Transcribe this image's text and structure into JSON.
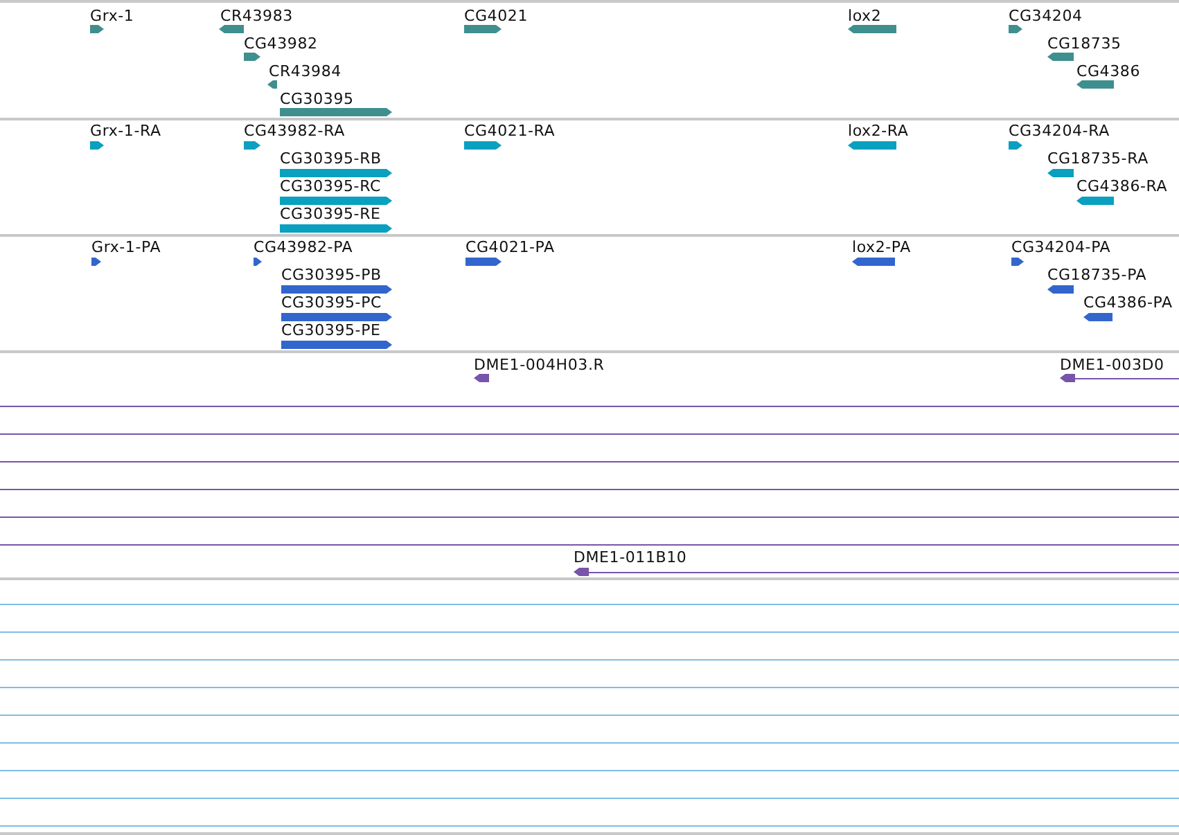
{
  "tracks": [
    {
      "color": "#3f8f8f",
      "features": [
        {
          "kind": "block",
          "label": "Grx-1",
          "reverse": false
        },
        {
          "kind": "block",
          "label": "CR43983",
          "reverse": true
        },
        {
          "kind": "block",
          "label": "CG43982",
          "reverse": false
        },
        {
          "kind": "block",
          "label": "CR43984",
          "reverse": true
        },
        {
          "kind": "block",
          "label": "CG30395",
          "reverse": false
        },
        {
          "kind": "block",
          "label": "CG4021",
          "reverse": false
        },
        {
          "kind": "block",
          "label": "lox2",
          "reverse": true
        },
        {
          "kind": "block",
          "label": "CG34204",
          "reverse": false
        },
        {
          "kind": "block",
          "label": "CG18735",
          "reverse": true
        },
        {
          "kind": "block",
          "label": "CG4386",
          "reverse": true
        }
      ]
    },
    {
      "color": "#0aa0bf",
      "features": [
        {
          "kind": "block",
          "label": "Grx-1-RA",
          "reverse": false
        },
        {
          "kind": "block",
          "label": "CG43982-RA",
          "reverse": false
        },
        {
          "kind": "block",
          "label": "CG30395-RB",
          "reverse": false
        },
        {
          "kind": "block",
          "label": "CG30395-RC",
          "reverse": false
        },
        {
          "kind": "block",
          "label": "CG30395-RE",
          "reverse": false
        },
        {
          "kind": "block",
          "label": "CG4021-RA",
          "reverse": false
        },
        {
          "kind": "block",
          "label": "lox2-RA",
          "reverse": true
        },
        {
          "kind": "block",
          "label": "CG34204-RA",
          "reverse": false
        },
        {
          "kind": "block",
          "label": "CG18735-RA",
          "reverse": true
        },
        {
          "kind": "block",
          "label": "CG4386-RA",
          "reverse": true
        }
      ]
    },
    {
      "color": "#3366cc",
      "features": [
        {
          "kind": "block",
          "label": "Grx-1-PA",
          "reverse": false
        },
        {
          "kind": "block",
          "label": "CG43982-PA",
          "reverse": false
        },
        {
          "kind": "block",
          "label": "CG30395-PB",
          "reverse": false
        },
        {
          "kind": "block",
          "label": "CG30395-PC",
          "reverse": false
        },
        {
          "kind": "block",
          "label": "CG30395-PE",
          "reverse": false
        },
        {
          "kind": "block",
          "label": "CG4021-PA",
          "reverse": false
        },
        {
          "kind": "block",
          "label": "lox2-PA",
          "reverse": true
        },
        {
          "kind": "block",
          "label": "CG34204-PA",
          "reverse": false
        },
        {
          "kind": "block",
          "label": "CG18735-PA",
          "reverse": true
        },
        {
          "kind": "block",
          "label": "CG4386-PA",
          "reverse": true
        }
      ]
    },
    {
      "color": "#7755aa",
      "features": [
        {
          "kind": "clone",
          "label": "DME1-004H03.R",
          "reverse": true
        },
        {
          "kind": "clone",
          "label": "DME1-003D0",
          "reverse": true
        },
        {
          "kind": "span"
        },
        {
          "kind": "span"
        },
        {
          "kind": "span"
        },
        {
          "kind": "span"
        },
        {
          "kind": "span"
        },
        {
          "kind": "span"
        },
        {
          "kind": "clone",
          "label": "DME1-011B10",
          "reverse": true
        }
      ]
    },
    {
      "color": "#7fbde6",
      "features": [
        {
          "kind": "span"
        },
        {
          "kind": "span"
        },
        {
          "kind": "span"
        },
        {
          "kind": "span"
        },
        {
          "kind": "span"
        },
        {
          "kind": "span"
        },
        {
          "kind": "span"
        },
        {
          "kind": "span"
        },
        {
          "kind": "span"
        }
      ]
    }
  ]
}
